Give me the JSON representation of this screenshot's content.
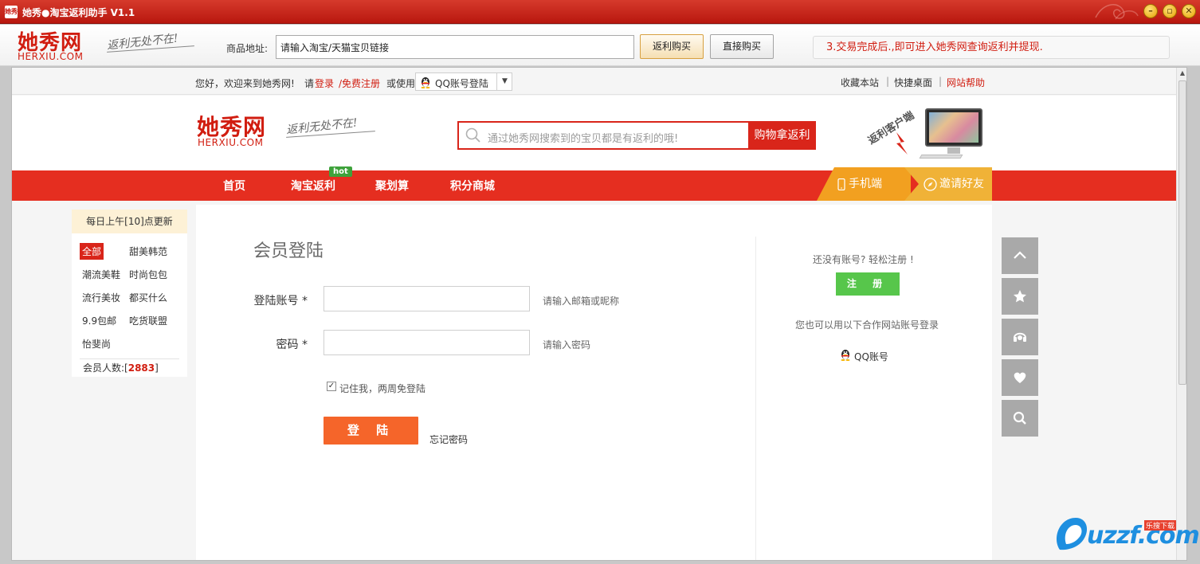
{
  "window": {
    "icon_text": "她秀",
    "title": "她秀●淘宝返利助手 V1.1",
    "buttons": [
      "minimize-icon",
      "maximize-icon",
      "close-icon"
    ]
  },
  "toolbar": {
    "logo_text": "她秀网",
    "logo_domain": "HERXIU.COM",
    "slogan": "返利无处不在!",
    "address_label": "商品地址:",
    "address_value": "请输入淘宝/天猫宝贝链接",
    "fanli_button": "返利购买",
    "direct_button": "直接购买",
    "notice": "3.交易完成后.,即可进入她秀网查询返利并提现."
  },
  "site": {
    "topbar": {
      "greeting": "您好，欢迎来到她秀网!",
      "please": "请",
      "login": "登录",
      "register": "/免费注册",
      "use": "或使用",
      "qq_login": "QQ账号登陆",
      "favorites": "收藏本站",
      "desktop": "快捷桌面",
      "help": "网站帮助",
      "separator": "|"
    },
    "header": {
      "logo_text": "她秀网",
      "logo_domain": "HERXIU.COM",
      "slogan": "返利无处不在!",
      "search_placeholder": "通过她秀网搜索到的宝贝都是有返利的哦!",
      "search_button": "购物拿返利",
      "promo_text": "返利客户端"
    },
    "nav": {
      "items": [
        "首页",
        "淘宝返利",
        "聚划算",
        "积分商城"
      ],
      "hot_badge": "hot",
      "mobile": "手机端",
      "invite": "邀请好友"
    },
    "sidebar": {
      "update_notice": "每日上午[10]点更新",
      "categories": [
        "全部",
        "甜美韩范",
        "潮流美鞋",
        "时尚包包",
        "流行美妆",
        "都买什么",
        "9.9包邮",
        "吃货联盟",
        "怡斐尚"
      ],
      "members_label": "会员人数:[",
      "members_count": "2883",
      "members_close": "]"
    },
    "login": {
      "title": "会员登陆",
      "account_label": "登陆账号",
      "password_label": "密码",
      "required_mark": "*",
      "account_hint": "请输入邮箱或昵称",
      "password_hint": "请输入密码",
      "remember": "记住我，两周免登陆",
      "remember_checked": true,
      "submit": "登 陆",
      "forgot": "忘记密码"
    },
    "register_panel": {
      "no_account": "还没有账号? 轻松注册 !",
      "register_button": "注 册",
      "partner_text": "您也可以用以下合作网站账号登录",
      "qq_account": "QQ账号"
    },
    "side_tools": [
      "back-to-top-icon",
      "star-icon",
      "headset-icon",
      "heart-icon",
      "search-icon"
    ]
  },
  "watermark": {
    "brand": "uzzf.com",
    "subtitle": "乐搜下载"
  },
  "colors": {
    "brand_red": "#d9251a",
    "nav_red": "#e52e20",
    "login_orange": "#f5652a",
    "register_green": "#57c64b",
    "mobile_tab": "#f2a020"
  }
}
